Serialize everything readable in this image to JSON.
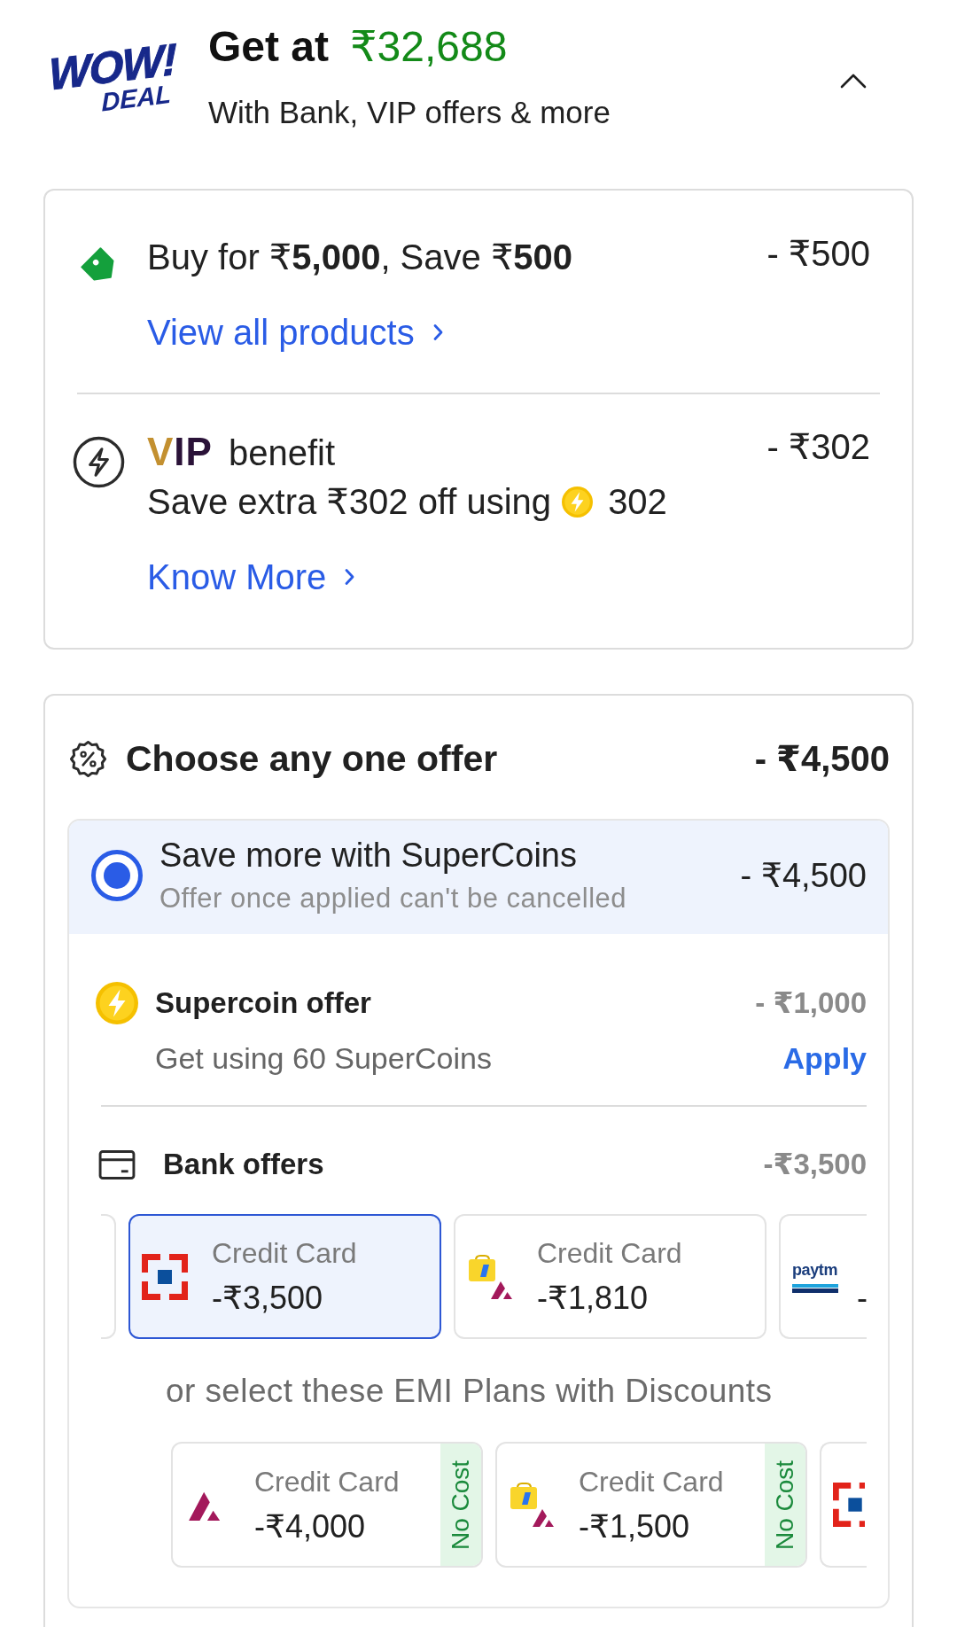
{
  "header": {
    "logo": {
      "line_1": "WOW!",
      "line_2": "DEAL"
    },
    "title": "Get at",
    "price": "₹32,688",
    "subtitle": "With Bank, VIP offers & more",
    "expanded": true
  },
  "deals": [
    {
      "kind": "tag",
      "text": "Buy for ₹**5,000**, Save ₹**500**",
      "amount": "- ₹500",
      "link": "View all products"
    },
    {
      "kind": "vip",
      "badge": "VIP",
      "title": "benefit",
      "text": "Save extra ₹302 off using",
      "coins": "302",
      "amount": "- ₹302",
      "link": "Know More"
    }
  ],
  "offer_group": {
    "title": "Choose any one offer",
    "amount": "- ₹4,500",
    "options": [
      {
        "selected": true,
        "title": "Save more with SuperCoins",
        "note": "Offer once applied can't be cancelled",
        "amount": "- ₹4,500",
        "supercoin": {
          "title": "Supercoin offer",
          "amount": "- ₹1,000",
          "detail": "Get using 60 SuperCoins",
          "action": "Apply"
        },
        "bank_offers": {
          "title": "Bank offers",
          "amount": "-₹3,500",
          "cards": [
            {
              "kind": "edge",
              "selected": false
            },
            {
              "kind": "full",
              "logo": {
                "kind": "hdfc"
              },
              "label": "Credit Card",
              "amount": "-₹3,500",
              "selected": true
            },
            {
              "kind": "full",
              "logo": {
                "kind": "flipkart-axis"
              },
              "label": "Credit Card",
              "amount": "-₹1,810",
              "selected": false
            },
            {
              "kind": "clipped",
              "logo": {
                "kind": "paytm",
                "text": "paytm"
              },
              "amount": "-",
              "selected": false
            }
          ]
        },
        "emi": {
          "heading": "or select these EMI Plans with Discounts",
          "cards": [
            {
              "kind": "full",
              "logo": {
                "kind": "axis"
              },
              "label": "Credit Card",
              "amount": "-₹4,000",
              "tag": "No Cost",
              "selected": false
            },
            {
              "kind": "full",
              "logo": {
                "kind": "flipkart-axis"
              },
              "label": "Credit Card",
              "amount": "-₹1,500",
              "tag": "No Cost",
              "selected": false
            },
            {
              "kind": "clipped",
              "logo": {
                "kind": "hdfc"
              },
              "selected": false
            }
          ]
        }
      }
    ]
  }
}
